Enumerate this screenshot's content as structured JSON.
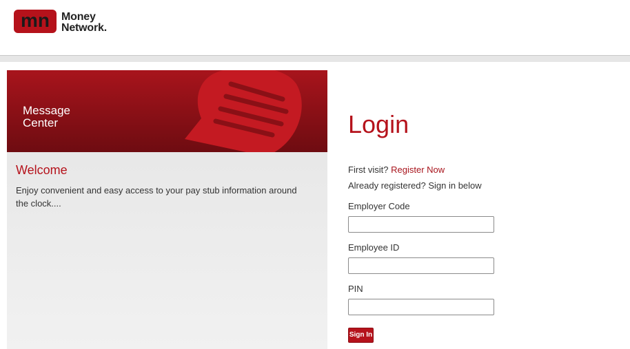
{
  "header": {
    "logo_line1": "Money",
    "logo_line2": "Network.",
    "logo_mark_letters": "mn",
    "brand_color": "#b5121b"
  },
  "banner": {
    "title": "Message Center",
    "icon": "message-bubble-icon"
  },
  "welcome": {
    "title": "Welcome",
    "text": "Enjoy convenient and easy access to your pay stub information around the clock...."
  },
  "login": {
    "title": "Login",
    "first_visit": "First visit?",
    "register_link": "Register Now",
    "already_registered": "Already registered? Sign in below",
    "fields": [
      {
        "label": "Employer Code",
        "value": ""
      },
      {
        "label": "Employee ID",
        "value": ""
      },
      {
        "label": "PIN",
        "value": ""
      }
    ],
    "submit": "Sign In"
  }
}
